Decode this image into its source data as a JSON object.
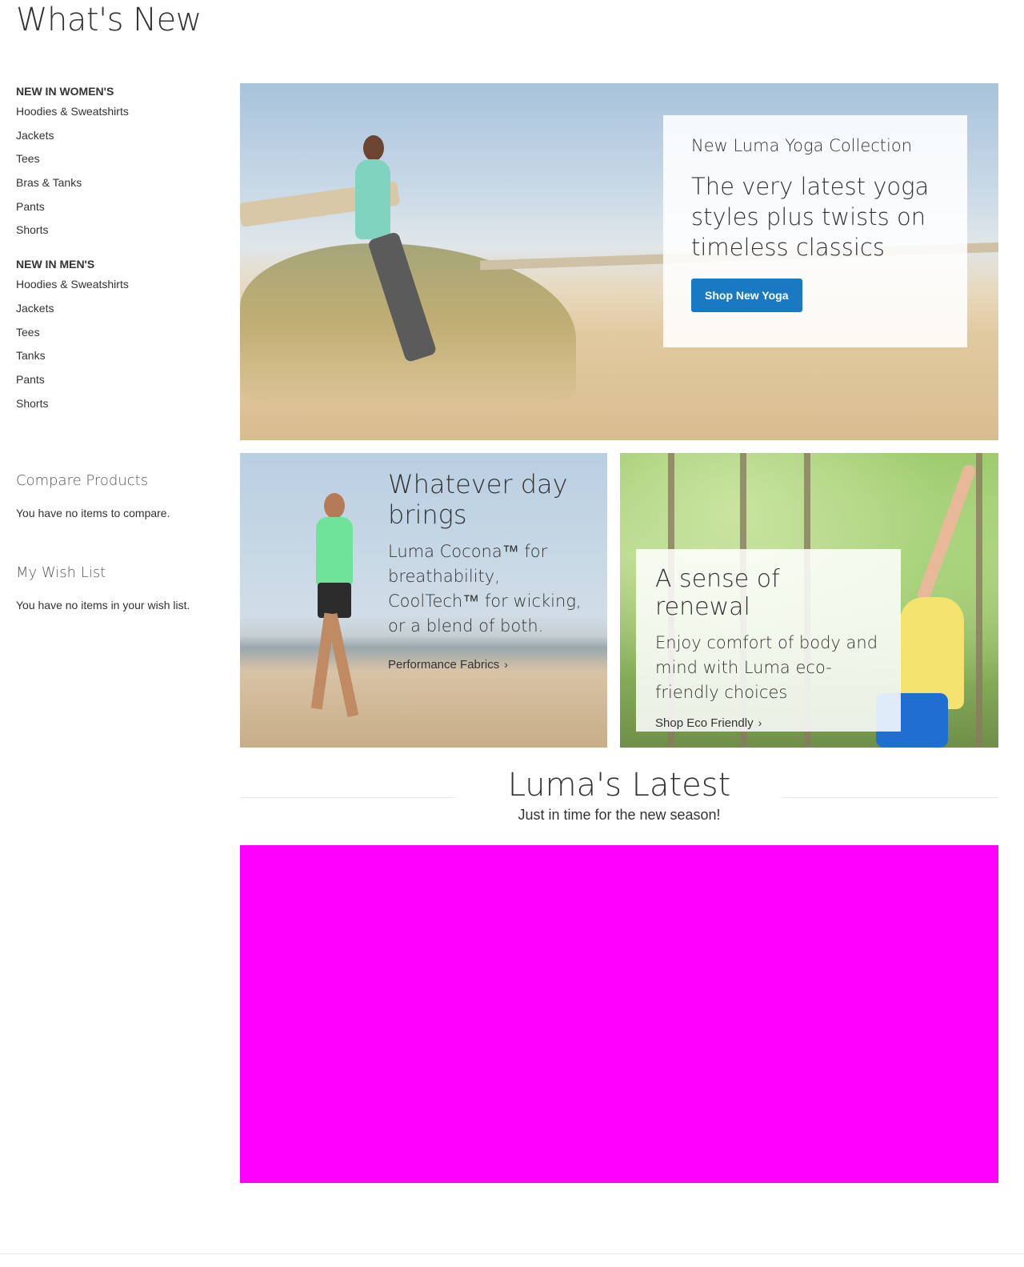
{
  "page": {
    "title": "What's New"
  },
  "sidebar": {
    "women": {
      "heading": "NEW IN WOMEN'S",
      "items": [
        "Hoodies & Sweatshirts",
        "Jackets",
        "Tees",
        "Bras & Tanks",
        "Pants",
        "Shorts"
      ]
    },
    "men": {
      "heading": "NEW IN MEN'S",
      "items": [
        "Hoodies & Sweatshirts",
        "Jackets",
        "Tees",
        "Tanks",
        "Pants",
        "Shorts"
      ]
    },
    "compare": {
      "title": "Compare Products",
      "empty": "You have no items to compare."
    },
    "wishlist": {
      "title": "My Wish List",
      "empty": "You have no items in your wish list."
    }
  },
  "hero": {
    "kicker": "New Luma Yoga Collection",
    "heading": "The very latest yoga styles plus twists on timeless classics",
    "button": "Shop New Yoga"
  },
  "promo_left": {
    "heading": "Whatever day brings",
    "body": "Luma Cocona™ for breathability, CoolTech™ for wicking, or a blend of both.",
    "link": "Performance Fabrics"
  },
  "promo_right": {
    "heading": "A sense of renewal",
    "body": "Enjoy comfort of body and mind with Luma eco-friendly choices",
    "link": "Shop Eco Friendly"
  },
  "latest": {
    "title": "Luma's Latest",
    "subtitle": "Just in time for the new season!"
  },
  "colors": {
    "primary_button": "#1979c3",
    "placeholder_block": "#ff00ff",
    "text": "#333333"
  },
  "icons": {
    "link_chevron": "chevron-right-icon"
  }
}
